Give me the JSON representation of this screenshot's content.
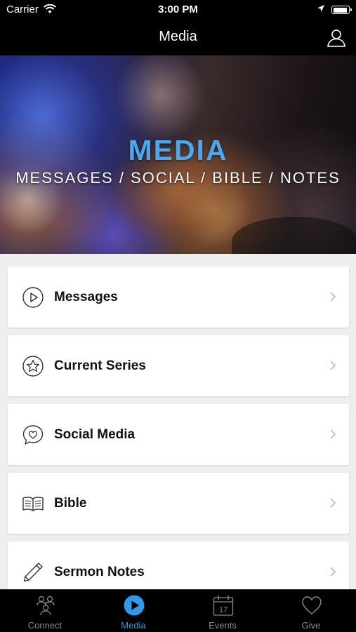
{
  "status_bar": {
    "carrier": "Carrier",
    "time": "3:00 PM"
  },
  "nav": {
    "title": "Media"
  },
  "hero": {
    "title": "MEDIA",
    "subtitle": "MESSAGES / SOCIAL / BIBLE / NOTES"
  },
  "menu": {
    "items": [
      {
        "label": "Messages",
        "icon": "play-circle-icon"
      },
      {
        "label": "Current Series",
        "icon": "star-circle-icon"
      },
      {
        "label": "Social Media",
        "icon": "heart-bubble-icon"
      },
      {
        "label": "Bible",
        "icon": "book-icon"
      },
      {
        "label": "Sermon Notes",
        "icon": "pencil-icon"
      }
    ]
  },
  "tabs": [
    {
      "label": "Connect",
      "icon": "people-icon",
      "active": false
    },
    {
      "label": "Media",
      "icon": "play-circle-icon",
      "active": true
    },
    {
      "label": "Events",
      "icon": "calendar-icon",
      "active": false,
      "calendar_day": "17"
    },
    {
      "label": "Give",
      "icon": "heart-icon",
      "active": false
    }
  ],
  "colors": {
    "accent": "#2f9ae8",
    "hero_title": "#4ba8ee",
    "background": "#eeeeef",
    "bars": "#000000"
  }
}
